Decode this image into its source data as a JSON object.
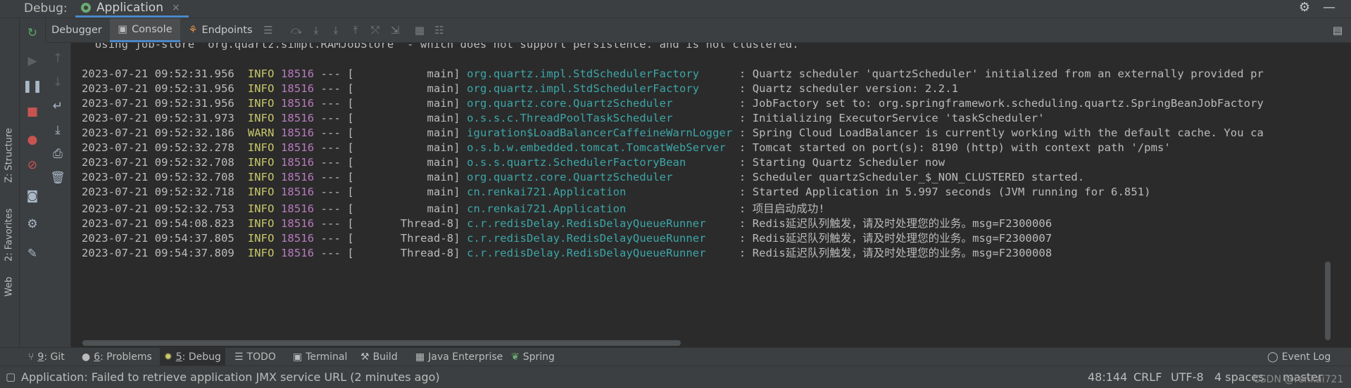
{
  "titlebar": {
    "label": "Debug:",
    "tab": "Application",
    "close": "×"
  },
  "left_stripe": {
    "structure": "Z: Structure",
    "favorites": "2: Favorites",
    "web": "Web"
  },
  "tabs": {
    "debugger": "Debugger",
    "console": "Console",
    "endpoints": "Endpoints"
  },
  "console": {
    "lines": [
      {
        "text": "  Using job-store 'org.quartz.simpl.RAMJobStore' - which does not support persistence. and is not clustered."
      },
      {
        "ts": "2023-07-21 09:52:31.956",
        "level": "INFO",
        "pid": "18516",
        "sep": "--- [",
        "thread": "           main]",
        "logger": "org.quartz.impl.StdSchedulerFactory     ",
        "msg": ": Quartz scheduler 'quartzScheduler' initialized from an externally provided pr"
      },
      {
        "ts": "2023-07-21 09:52:31.956",
        "level": "INFO",
        "pid": "18516",
        "sep": "--- [",
        "thread": "           main]",
        "logger": "org.quartz.impl.StdSchedulerFactory     ",
        "msg": ": Quartz scheduler version: 2.2.1"
      },
      {
        "ts": "2023-07-21 09:52:31.956",
        "level": "INFO",
        "pid": "18516",
        "sep": "--- [",
        "thread": "           main]",
        "logger": "org.quartz.core.QuartzScheduler         ",
        "msg": ": JobFactory set to: org.springframework.scheduling.quartz.SpringBeanJobFactory"
      },
      {
        "ts": "2023-07-21 09:52:31.973",
        "level": "INFO",
        "pid": "18516",
        "sep": "--- [",
        "thread": "           main]",
        "logger": "o.s.s.c.ThreadPoolTaskScheduler         ",
        "msg": ": Initializing ExecutorService 'taskScheduler'"
      },
      {
        "ts": "2023-07-21 09:52:32.186",
        "level": "WARN",
        "pid": "18516",
        "sep": "--- [",
        "thread": "           main]",
        "logger": "iguration$LoadBalancerCaffeineWarnLogger",
        "msg": ": Spring Cloud LoadBalancer is currently working with the default cache. You ca"
      },
      {
        "ts": "2023-07-21 09:52:32.278",
        "level": "INFO",
        "pid": "18516",
        "sep": "--- [",
        "thread": "           main]",
        "logger": "o.s.b.w.embedded.tomcat.TomcatWebServer ",
        "msg": ": Tomcat started on port(s): 8190 (http) with context path '/pms'"
      },
      {
        "ts": "2023-07-21 09:52:32.708",
        "level": "INFO",
        "pid": "18516",
        "sep": "--- [",
        "thread": "           main]",
        "logger": "o.s.s.quartz.SchedulerFactoryBean       ",
        "msg": ": Starting Quartz Scheduler now"
      },
      {
        "ts": "2023-07-21 09:52:32.708",
        "level": "INFO",
        "pid": "18516",
        "sep": "--- [",
        "thread": "           main]",
        "logger": "org.quartz.core.QuartzScheduler         ",
        "msg": ": Scheduler quartzScheduler_$_NON_CLUSTERED started."
      },
      {
        "ts": "2023-07-21 09:52:32.718",
        "level": "INFO",
        "pid": "18516",
        "sep": "--- [",
        "thread": "           main]",
        "logger": "cn.renkai721.Application                ",
        "msg": ": Started Application in 5.997 seconds (JVM running for 6.851)"
      },
      {
        "ts": "2023-07-21 09:52:32.753",
        "level": "INFO",
        "pid": "18516",
        "sep": "--- [",
        "thread": "           main]",
        "logger": "cn.renkai721.Application                ",
        "msg": ": 项目启动成功!"
      },
      {
        "ts": "2023-07-21 09:54:08.823",
        "level": "INFO",
        "pid": "18516",
        "sep": "--- [",
        "thread": "       Thread-8]",
        "logger": "c.r.redisDelay.RedisDelayQueueRunner    ",
        "msg": ": Redis延迟队列触发，请及时处理您的业务。msg=F2300006"
      },
      {
        "ts": "2023-07-21 09:54:37.805",
        "level": "INFO",
        "pid": "18516",
        "sep": "--- [",
        "thread": "       Thread-8]",
        "logger": "c.r.redisDelay.RedisDelayQueueRunner    ",
        "msg": ": Redis延迟队列触发，请及时处理您的业务。msg=F2300007"
      },
      {
        "ts": "2023-07-21 09:54:37.809",
        "level": "INFO",
        "pid": "18516",
        "sep": "--- [",
        "thread": "       Thread-8]",
        "logger": "c.r.redisDelay.RedisDelayQueueRunner    ",
        "msg": ": Redis延迟队列触发，请及时处理您的业务。msg=F2300008"
      }
    ]
  },
  "bottom_tabs": [
    {
      "num": "9",
      "label": ": Git"
    },
    {
      "num": "6",
      "label": ": Problems"
    },
    {
      "num": "5",
      "label": ": Debug"
    },
    {
      "num": "",
      "label": "TODO"
    },
    {
      "num": "",
      "label": "Terminal"
    },
    {
      "num": "",
      "label": "Build"
    },
    {
      "num": "",
      "label": "Java Enterprise"
    },
    {
      "num": "",
      "label": "Spring"
    }
  ],
  "event_log": "Event Log",
  "status": {
    "message": "Application: Failed to retrieve application JMX service URL (2 minutes ago)",
    "position": "48:144",
    "line_sep": "CRLF",
    "encoding": "UTF-8",
    "indent": "4 spaces",
    "branch": "master",
    "watermark": "CSDN @renkai721"
  },
  "colors": {
    "accent": "#4a88c7",
    "logger": "#3da6a8",
    "level": "#c8c86b",
    "pid": "#b87bbf"
  },
  "icons": [
    "rerun-icon",
    "resume-icon",
    "pause-icon",
    "stop-icon",
    "view-breakpoints-icon",
    "mute-breakpoints-icon",
    "camera-icon",
    "settings-icon",
    "pin-icon",
    "gear-icon",
    "minimize-icon"
  ]
}
